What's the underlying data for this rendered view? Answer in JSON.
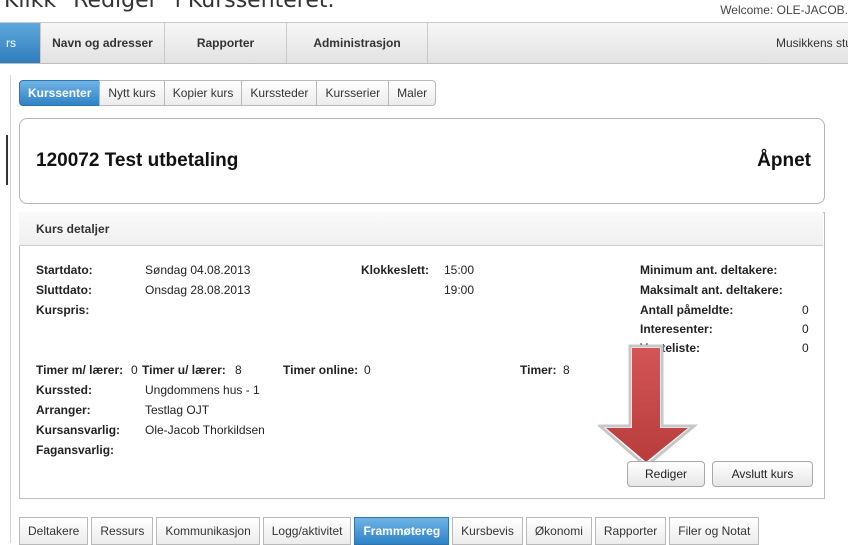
{
  "caption": "Klikk \"Rediger\" i Kurssenteret.",
  "welcome": "Welcome: OLE-JACOB.",
  "topnav": {
    "first_label": "rs",
    "items": [
      "Navn og adresser",
      "Rapporter",
      "Administrasjon"
    ],
    "right": "Musikkens studiefo"
  },
  "tabs": [
    "Kurssenter",
    "Nytt kurs",
    "Kopier kurs",
    "Kurssteder",
    "Kursserier",
    "Maler"
  ],
  "course": {
    "title": "120072 Test utbetaling",
    "status": "Åpnet"
  },
  "details": {
    "heading": "Kurs detaljer",
    "startdato_label": "Startdato:",
    "startdato": "Søndag 04.08.2013",
    "sluttdato_label": "Sluttdato:",
    "sluttdato": "Onsdag 28.08.2013",
    "kurspris_label": "Kurspris:",
    "klokkeslett_label": "Klokkeslett:",
    "klokkeslett_start": "15:00",
    "klokkeslett_end": "19:00",
    "min_label": "Minimum ant. deltakere:",
    "max_label": "Maksimalt ant. deltakere:",
    "pameldte_label": "Antall påmeldte:",
    "pameldte": "0",
    "interesenter_label": "Interesenter:",
    "interesenter": "0",
    "venteliste_label": "Venteliste:",
    "venteliste": "0",
    "timer_m_label": "Timer m/ lærer:",
    "timer_m": "0",
    "timer_u_label": "Timer u/ lærer:",
    "timer_u": "8",
    "timer_online_label": "Timer online:",
    "timer_online": "0",
    "timer_label": "Timer:",
    "timer": "8",
    "kurssted_label": "Kurssted:",
    "kurssted": "Ungdommens hus - 1",
    "arranger_label": "Arranger:",
    "arranger": "Testlag OJT",
    "kursansvarlig_label": "Kursansvarlig:",
    "kursansvarlig": "Ole-Jacob Thorkildsen",
    "fagansvarlig_label": "Fagansvarlig:"
  },
  "buttons": {
    "edit": "Rediger",
    "close_course": "Avslutt kurs"
  },
  "bottom_tabs": [
    "Deltakere",
    "Ressurs",
    "Kommunikasjon",
    "Logg/aktivitet",
    "Frammøtereg",
    "Kursbevis",
    "Økonomi",
    "Rapporter",
    "Filer og Notat"
  ],
  "colors": {
    "accent": "#2e82c6",
    "arrow": "#c84a4a"
  }
}
